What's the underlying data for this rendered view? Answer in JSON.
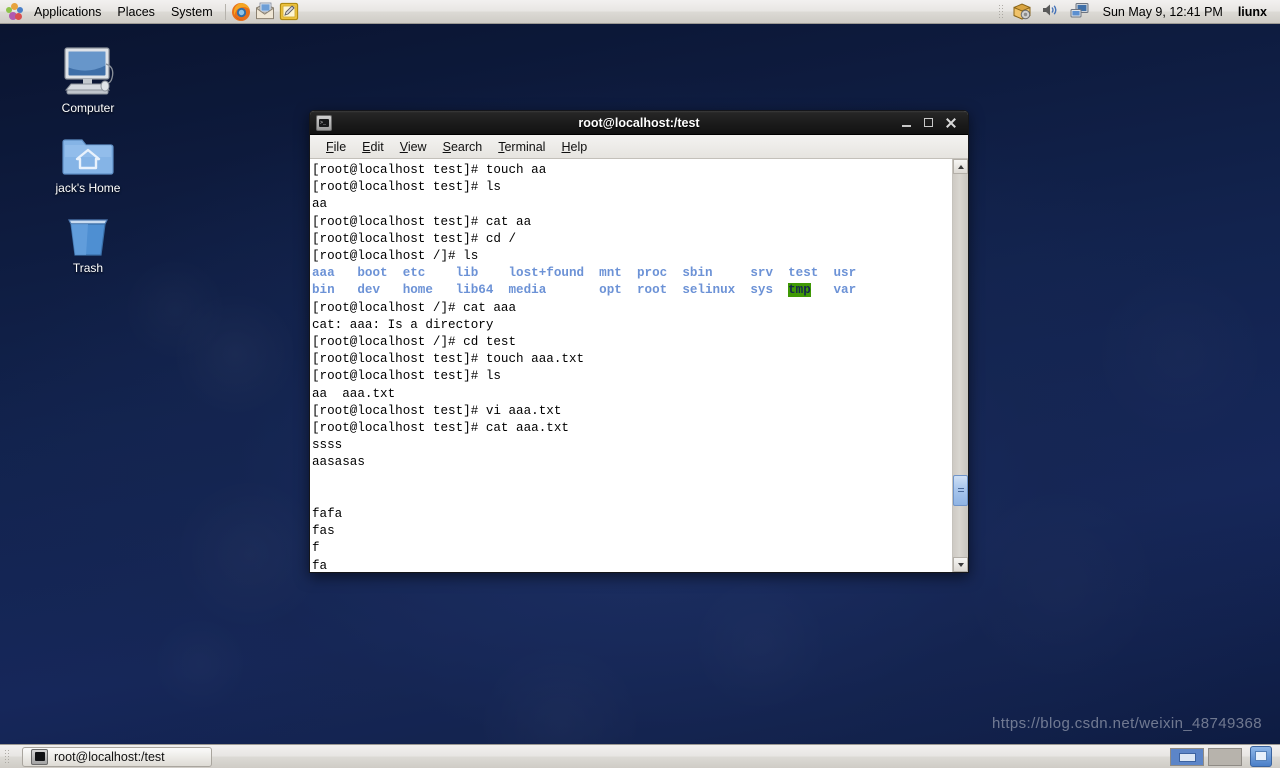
{
  "top_panel": {
    "menus": [
      "Applications",
      "Places",
      "System"
    ],
    "launchers": [
      {
        "name": "firefox-launcher",
        "label": "Firefox Web Browser"
      },
      {
        "name": "evolution-launcher",
        "label": "Evolution Mail"
      },
      {
        "name": "text-editor-launcher",
        "label": "Text Editor"
      }
    ],
    "tray": [
      {
        "name": "package-update-icon",
        "label": "Software Update"
      },
      {
        "name": "volume-icon",
        "label": "Volume"
      },
      {
        "name": "network-icon",
        "label": "Network"
      }
    ],
    "clock": "Sun May  9, 12:41 PM",
    "user": "liunx"
  },
  "desktop": {
    "icons": [
      {
        "name": "computer",
        "label": "Computer",
        "icon": "computer-icon"
      },
      {
        "name": "home",
        "label": "jack's Home",
        "icon": "home-folder-icon"
      },
      {
        "name": "trash",
        "label": "Trash",
        "icon": "trash-icon"
      }
    ]
  },
  "terminal": {
    "title": "root@localhost:/test",
    "icon": "terminal-icon",
    "window_buttons": {
      "minimize": "Minimize",
      "maximize": "Maximize",
      "close": "Close"
    },
    "menubar": [
      {
        "name": "file",
        "label": "File",
        "mnemonic": "F"
      },
      {
        "name": "edit",
        "label": "Edit",
        "mnemonic": "E"
      },
      {
        "name": "view",
        "label": "View",
        "mnemonic": "V"
      },
      {
        "name": "search",
        "label": "Search",
        "mnemonic": "S"
      },
      {
        "name": "terminal",
        "label": "Terminal",
        "mnemonic": "T"
      },
      {
        "name": "help",
        "label": "Help",
        "mnemonic": "H"
      }
    ],
    "lines": [
      {
        "type": "plain",
        "text": "[root@localhost test]# touch aa"
      },
      {
        "type": "plain",
        "text": "[root@localhost test]# ls"
      },
      {
        "type": "plain",
        "text": "aa"
      },
      {
        "type": "plain",
        "text": "[root@localhost test]# cat aa"
      },
      {
        "type": "plain",
        "text": "[root@localhost test]# cd /"
      },
      {
        "type": "plain",
        "text": "[root@localhost /]# ls"
      },
      {
        "type": "ls1",
        "text": "aaa   boot  etc    lib    lost+found  mnt  proc  sbin     srv  test  usr"
      },
      {
        "type": "ls2",
        "pre": "bin   dev   home   lib64  media       opt  root  selinux  sys  ",
        "hl": "tmp",
        "post": "   var"
      },
      {
        "type": "plain",
        "text": "[root@localhost /]# cat aaa"
      },
      {
        "type": "plain",
        "text": "cat: aaa: Is a directory"
      },
      {
        "type": "plain",
        "text": "[root@localhost /]# cd test"
      },
      {
        "type": "plain",
        "text": "[root@localhost test]# touch aaa.txt"
      },
      {
        "type": "plain",
        "text": "[root@localhost test]# ls"
      },
      {
        "type": "plain",
        "text": "aa  aaa.txt"
      },
      {
        "type": "plain",
        "text": "[root@localhost test]# vi aaa.txt"
      },
      {
        "type": "plain",
        "text": "[root@localhost test]# cat aaa.txt"
      },
      {
        "type": "plain",
        "text": "ssss"
      },
      {
        "type": "plain",
        "text": "aasasas"
      },
      {
        "type": "plain",
        "text": ""
      },
      {
        "type": "plain",
        "text": ""
      },
      {
        "type": "plain",
        "text": "fafa"
      },
      {
        "type": "plain",
        "text": "fas"
      },
      {
        "type": "plain",
        "text": "f"
      },
      {
        "type": "plain",
        "text": "fa"
      }
    ],
    "colors": {
      "background": "#ffffff",
      "foreground": "#000000",
      "directory": "#6c92d6",
      "highlight_bg": "#3f9905",
      "highlight_fg": "#13294b"
    }
  },
  "bottom_panel": {
    "task_button": "root@localhost:/test",
    "task_icon": "terminal-icon",
    "workspaces": [
      {
        "name": "workspace-1",
        "active": true
      },
      {
        "name": "workspace-2",
        "active": false
      }
    ],
    "show_desktop": "Show Desktop"
  },
  "watermark": "https://blog.csdn.net/weixin_48749368"
}
